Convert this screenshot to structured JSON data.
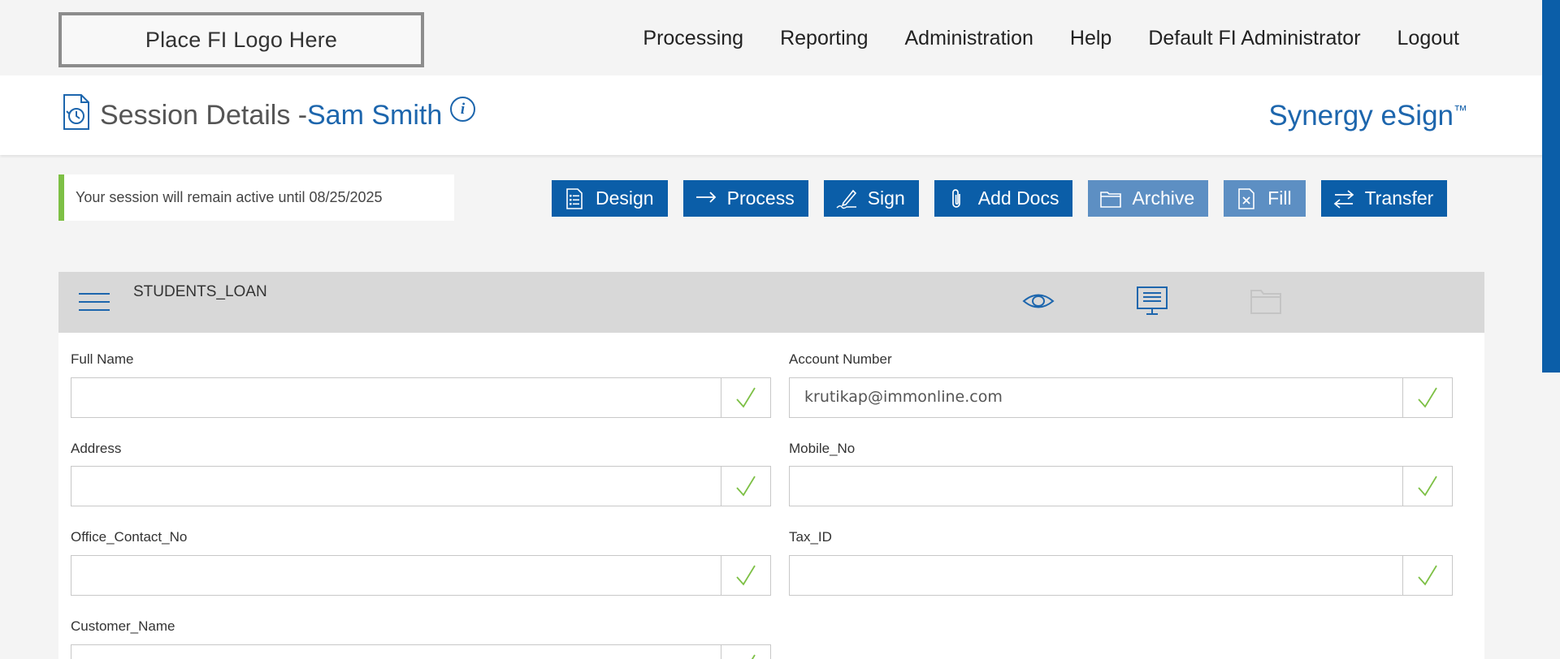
{
  "header": {
    "logo_text": "Place FI Logo Here",
    "nav": [
      "Processing",
      "Reporting",
      "Administration",
      "Help",
      "Default FI Administrator",
      "Logout"
    ]
  },
  "title": {
    "prefix": "Session Details -",
    "name": "Sam Smith",
    "info_icon": "i",
    "brand": "Synergy eSign",
    "brand_mark": "™"
  },
  "session_note": "Your session will remain active until 08/25/2025",
  "actions": [
    {
      "label": "Design",
      "icon": "checklist-icon",
      "enabled": true
    },
    {
      "label": "Process",
      "icon": "arrow-right-icon",
      "enabled": true
    },
    {
      "label": "Sign",
      "icon": "pen-icon",
      "enabled": true
    },
    {
      "label": "Add Docs",
      "icon": "paperclip-icon",
      "enabled": true
    },
    {
      "label": "Archive",
      "icon": "folder-icon",
      "enabled": false
    },
    {
      "label": "Fill",
      "icon": "document-edit-icon",
      "enabled": false
    },
    {
      "label": "Transfer",
      "icon": "swap-arrows-icon",
      "enabled": true
    }
  ],
  "panel": {
    "title": "STUDENTS_LOAN",
    "icons": [
      "eye-icon",
      "monitor-icon",
      "folder-icon"
    ]
  },
  "fields": [
    {
      "label": "Full Name",
      "value": ""
    },
    {
      "label": "Account Number",
      "value": "krutikap@immonline.com"
    },
    {
      "label": "Address",
      "value": ""
    },
    {
      "label": "Mobile_No",
      "value": ""
    },
    {
      "label": "Office_Contact_No",
      "value": ""
    },
    {
      "label": "Tax_ID",
      "value": ""
    },
    {
      "label": "Customer_Name",
      "value": ""
    }
  ],
  "colors": {
    "primary": "#0b5ea8",
    "disabled": "#5d8fc3",
    "link": "#1d66ad",
    "accent_green": "#7dc045"
  }
}
